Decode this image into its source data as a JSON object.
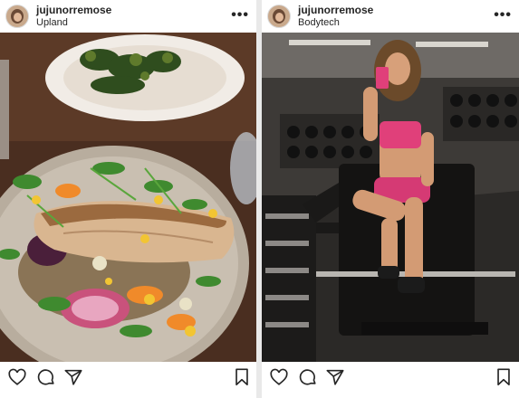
{
  "posts": [
    {
      "username": "jujunorremose",
      "location": "Upland",
      "photo_subject": "plated fish with greens and edible flowers",
      "icons": [
        "heart-icon",
        "comment-icon",
        "share-icon",
        "bookmark-icon"
      ]
    },
    {
      "username": "jujunorremose",
      "location": "Bodytech",
      "photo_subject": "gym mirror selfie",
      "icons": [
        "heart-icon",
        "comment-icon",
        "share-icon",
        "bookmark-icon"
      ]
    }
  ],
  "colors": {
    "text": "#262626",
    "border": "#dbdbdb",
    "accent_pink": "#e0407a"
  }
}
